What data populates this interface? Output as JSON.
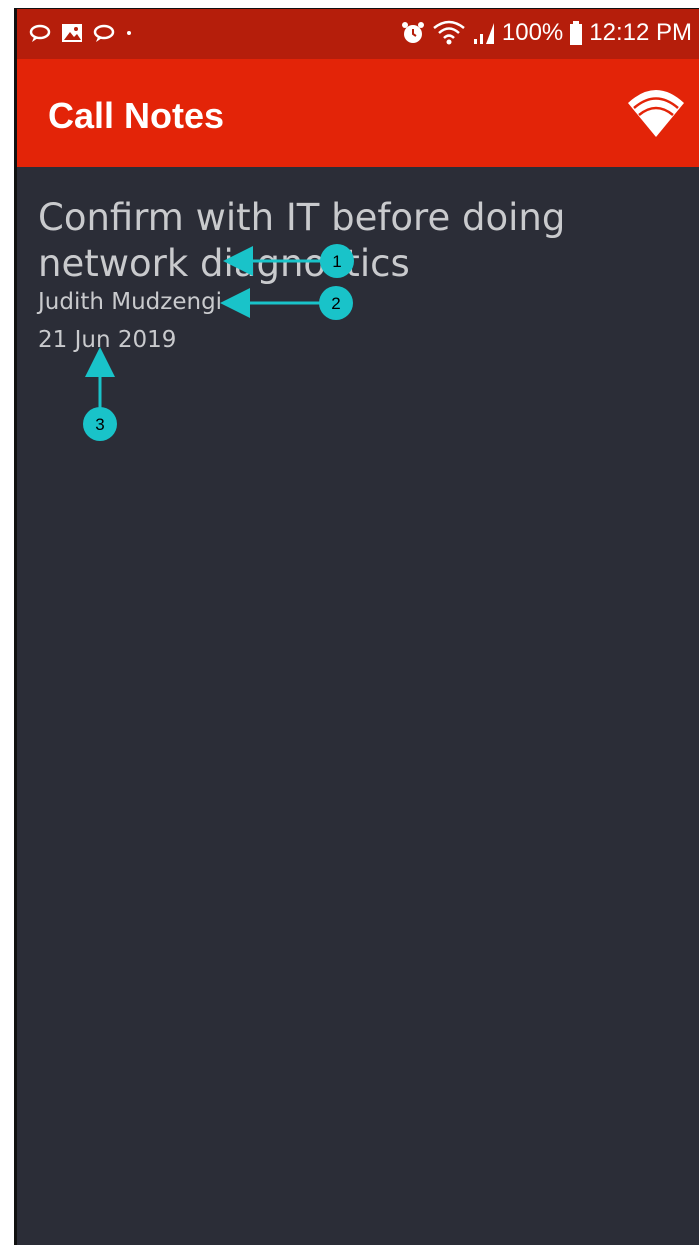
{
  "status_bar": {
    "battery": "100%",
    "time": "12:12 PM",
    "left_icons": [
      "chat-bubble-icon",
      "image-icon",
      "chat-bubble-icon",
      "dot-icon"
    ],
    "right_icons": [
      "alarm-icon",
      "wifi-signal-icon",
      "cell-signal-icon",
      "battery-icon"
    ]
  },
  "app_bar": {
    "title": "Call Notes",
    "action_icon": "wifi-icon"
  },
  "note": {
    "title": "Confirm with IT before doing network diagnostics",
    "author": "Judith Mudzengi",
    "date": "21 Jun 2019"
  },
  "callouts": [
    {
      "number": "1"
    },
    {
      "number": "2"
    },
    {
      "number": "3"
    }
  ],
  "colors": {
    "status_bar": "#b51e0b",
    "app_bar": "#e32408",
    "background": "#2b2d37",
    "text": "#c9cacd",
    "callout": "#19c3c9"
  }
}
